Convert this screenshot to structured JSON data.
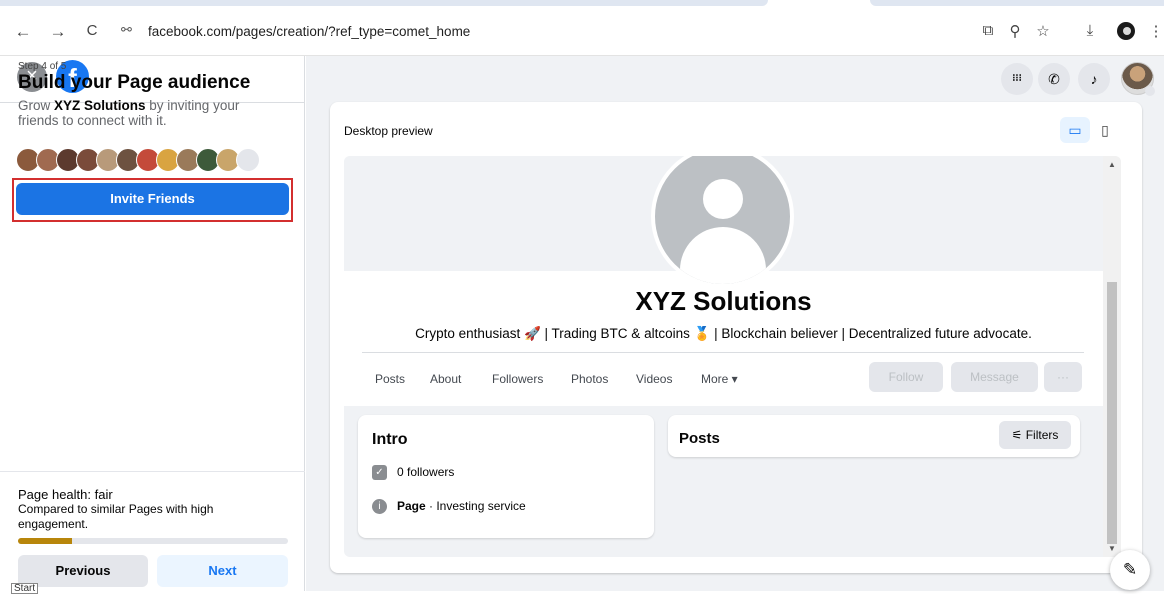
{
  "browser": {
    "url": "facebook.com/pages/creation/?ref_type=comet_home",
    "back_icon": "←",
    "forward_icon": "→",
    "reload_icon": "C",
    "site_info_icon": "⚯",
    "cast_icon": "⧉",
    "zoom_icon": "⚲",
    "star_icon": "☆",
    "download_icon": "⤓",
    "menu_icon": "⋮"
  },
  "left": {
    "close_icon": "×",
    "logo_letter": "f",
    "step": "Step 4 of 5",
    "title": "Build your Page audience",
    "subtitle_pre": "Grow ",
    "subtitle_bold": "XYZ Solutions",
    "subtitle_post": " by inviting your friends to connect with it.",
    "invite_label": "Invite Friends",
    "health_title": "Page health: fair",
    "health_desc": "Compared to similar Pages with high engagement.",
    "health_fraction": 0.2,
    "prev_label": "Previous",
    "next_label": "Next",
    "tooltip": "Start"
  },
  "topbar": {
    "menu_icon": "⁝⁝⁝",
    "messenger_icon": "✆",
    "bell_icon": "♪"
  },
  "preview": {
    "label": "Desktop preview",
    "desktop_icon": "▭",
    "mobile_icon": "▯",
    "page_name": "XYZ Solutions",
    "bio": "Crypto enthusiast 🚀 | Trading BTC & altcoins 🏅 | Blockchain believer | Decentralized future advocate.",
    "tabs": [
      "Posts",
      "About",
      "Followers",
      "Photos",
      "Videos",
      "More ▾"
    ],
    "follow_label": "Follow",
    "message_label": "Message",
    "more_label": "···",
    "intro_title": "Intro",
    "followers_text": "0 followers",
    "page_label": "Page",
    "page_category": " · Investing service",
    "posts_title": "Posts",
    "filters_label": "Filters",
    "edit_icon": "✎"
  },
  "colors": {
    "fb_blue": "#1877f2",
    "button_blue": "#1b74e4",
    "highlight_red": "#d32f2f",
    "health_bar": "#b8860b"
  }
}
